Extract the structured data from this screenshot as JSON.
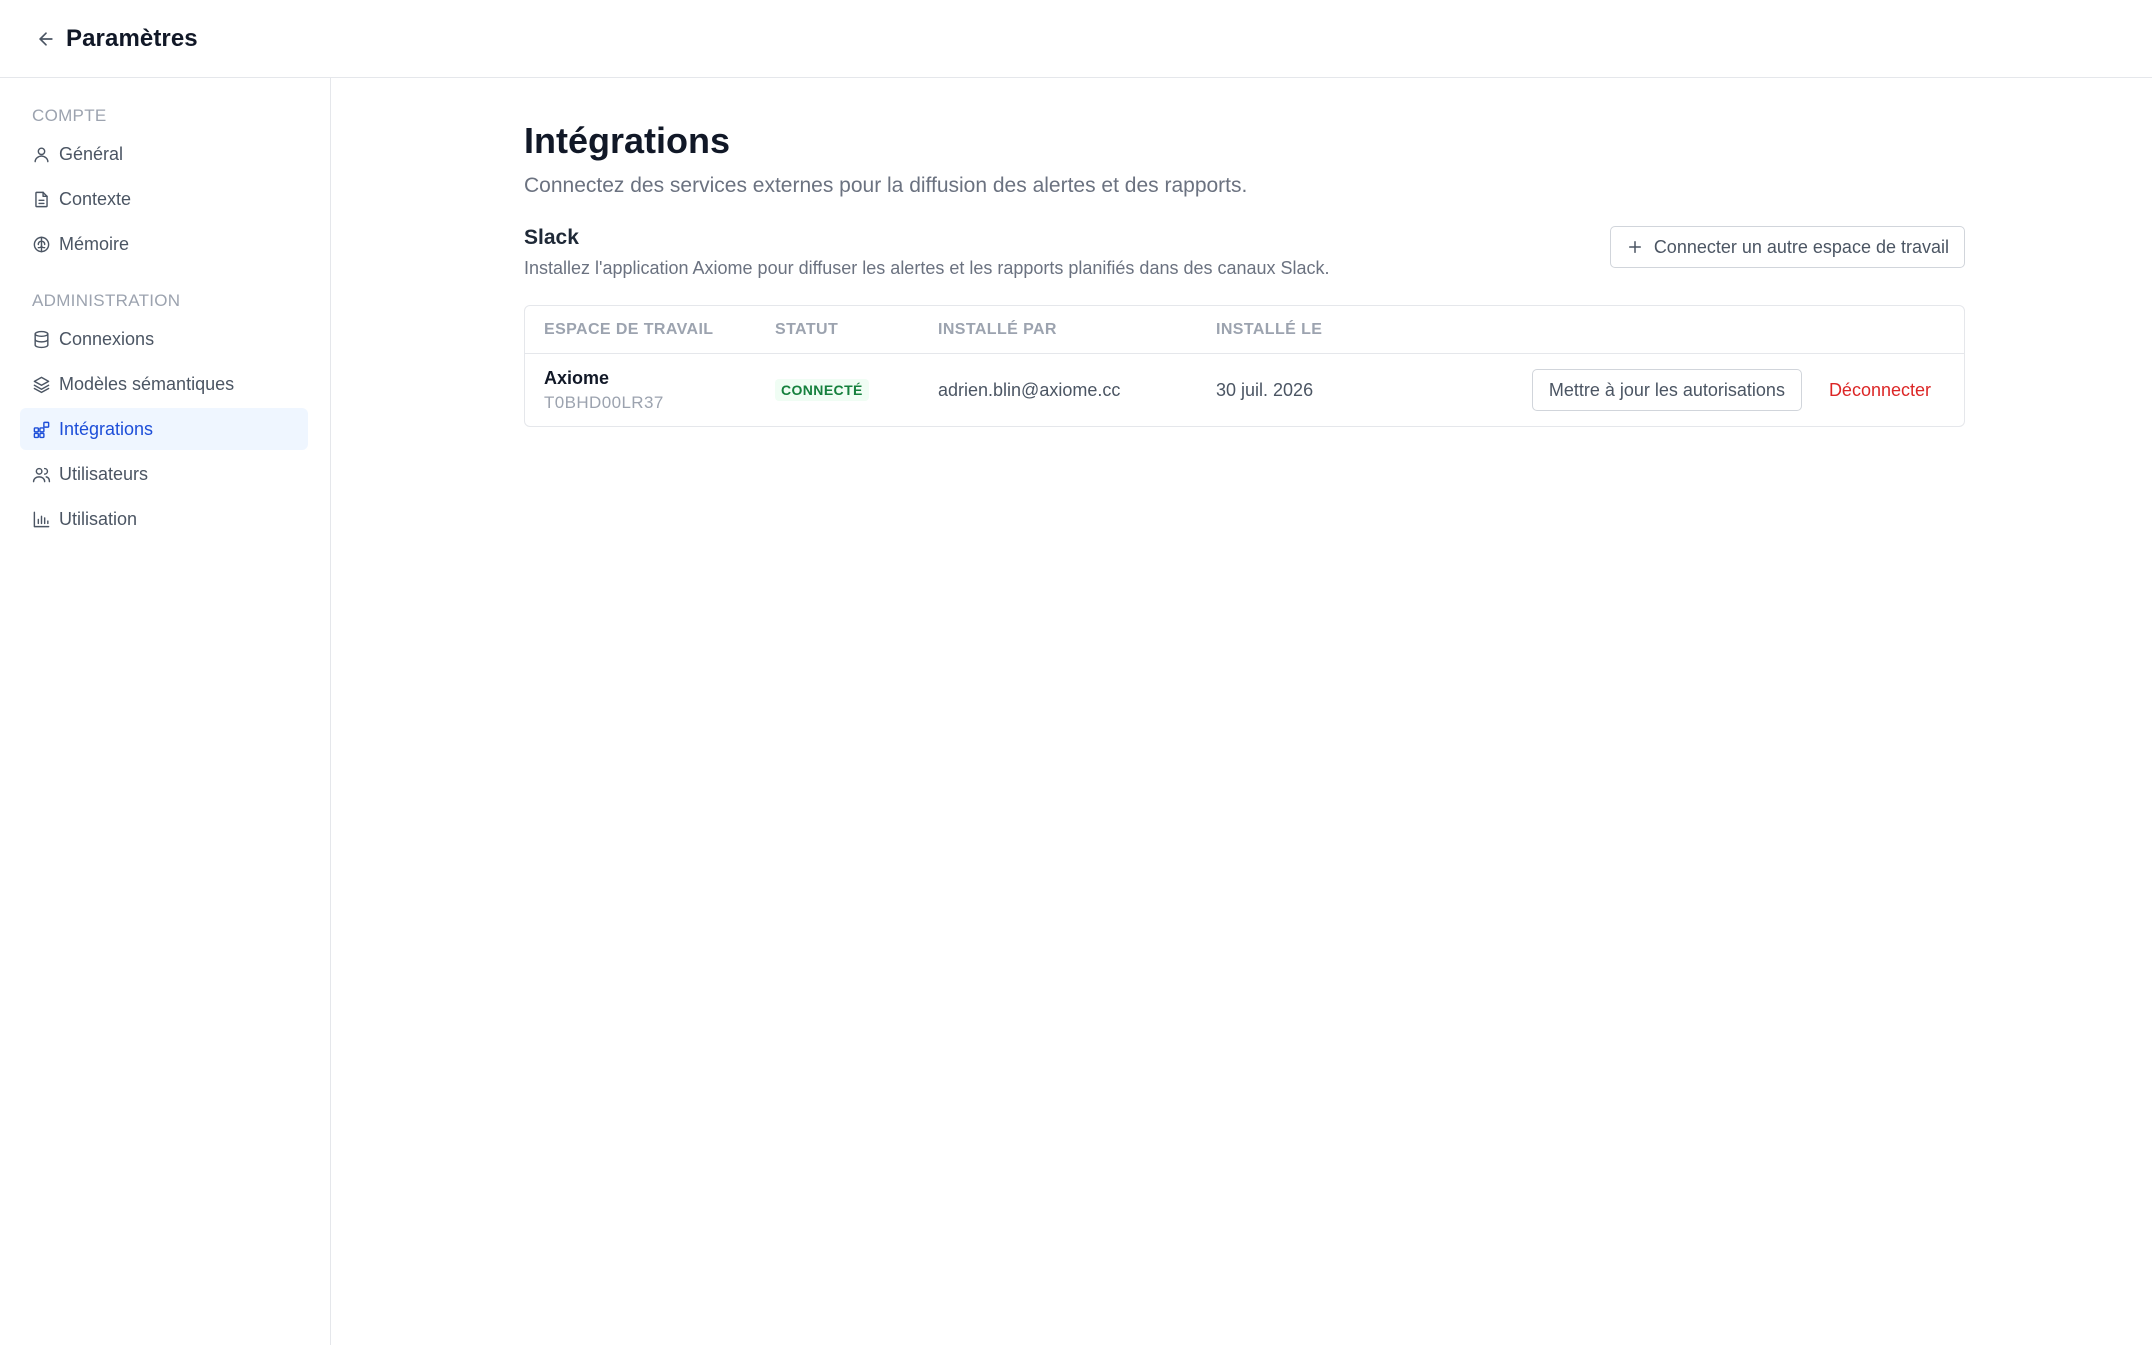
{
  "header": {
    "title": "Paramètres",
    "back_icon": "arrow-left-icon"
  },
  "sidebar": {
    "sections": [
      {
        "label": "COMPTE",
        "items": [
          {
            "label": "Général",
            "icon": "user-icon"
          },
          {
            "label": "Contexte",
            "icon": "file-text-icon"
          },
          {
            "label": "Mémoire",
            "icon": "brain-icon"
          }
        ]
      },
      {
        "label": "ADMINISTRATION",
        "items": [
          {
            "label": "Connexions",
            "icon": "database-icon"
          },
          {
            "label": "Modèles sémantiques",
            "icon": "layers-icon"
          },
          {
            "label": "Intégrations",
            "icon": "grid-plus-icon",
            "active": true
          },
          {
            "label": "Utilisateurs",
            "icon": "users-icon"
          },
          {
            "label": "Utilisation",
            "icon": "bar-chart-icon"
          }
        ]
      }
    ]
  },
  "main": {
    "title": "Intégrations",
    "subtitle": "Connectez des services externes pour la diffusion des alertes et des rapports.",
    "slack": {
      "title": "Slack",
      "description": "Installez l'application Axiome pour diffuser les alertes et les rapports planifiés dans des canaux Slack.",
      "connect_button": "Connecter un autre espace de travail",
      "table": {
        "columns": [
          "ESPACE DE TRAVAIL",
          "STATUT",
          "INSTALLÉ PAR",
          "INSTALLÉ LE"
        ],
        "rows": [
          {
            "workspace_name": "Axiome",
            "workspace_id": "T0BHD00LR37",
            "status": "CONNECTÉ",
            "installed_by": "adrien.blin@axiome.cc",
            "installed_on": "30 juil. 2026",
            "update_button": "Mettre à jour les autorisations",
            "disconnect_link": "Déconnecter"
          }
        ]
      }
    }
  },
  "colors": {
    "accent": "#1d4ed8",
    "active_bg": "#eff6ff",
    "success": "#15803d",
    "danger": "#dc2626"
  }
}
